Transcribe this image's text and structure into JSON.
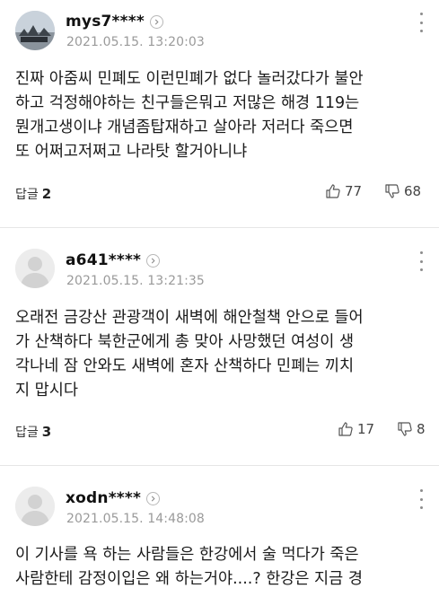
{
  "comments": [
    {
      "username": "mys7****",
      "timestamp": "2021.05.15. 13:20:03",
      "lines": [
        "진짜 아줌씨 민폐도 이런민폐가 없다 놀러갔다가 불안",
        "하고 걱정해야하는 친구들은뭐고 저많은 해경 119는",
        "뭔개고생이냐 개념좀탑재하고 살아라 저러다 죽으면",
        "또 어쩌고저쩌고 나라탓 할거아니냐"
      ],
      "reply_label": "답글",
      "reply_count": "2",
      "likes": "77",
      "dislikes": "68"
    },
    {
      "username": "a641****",
      "timestamp": "2021.05.15. 13:21:35",
      "lines": [
        "오래전 금강산 관광객이 새벽에 해안철책 안으로 들어",
        "가 산책하다 북한군에게 총 맞아 사망했던 여성이 생",
        "각나네 잠 안와도 새벽에 혼자 산책하다 민폐는 끼치",
        "지 맙시다"
      ],
      "reply_label": "답글",
      "reply_count": "3",
      "likes": "17",
      "dislikes": "8"
    },
    {
      "username": "xodn****",
      "timestamp": "2021.05.15. 14:48:08",
      "lines": [
        "이 기사를 욕 하는 사람들은 한강에서 술 먹다가 죽은",
        "사람한테 감정이입은 왜 하는거야....? 한강은 지금 경"
      ]
    }
  ],
  "icons": {
    "more": "kebab-icon",
    "profile_link": "chevron-right-icon",
    "like": "thumbs-up-icon",
    "dislike": "thumbs-down-icon"
  }
}
